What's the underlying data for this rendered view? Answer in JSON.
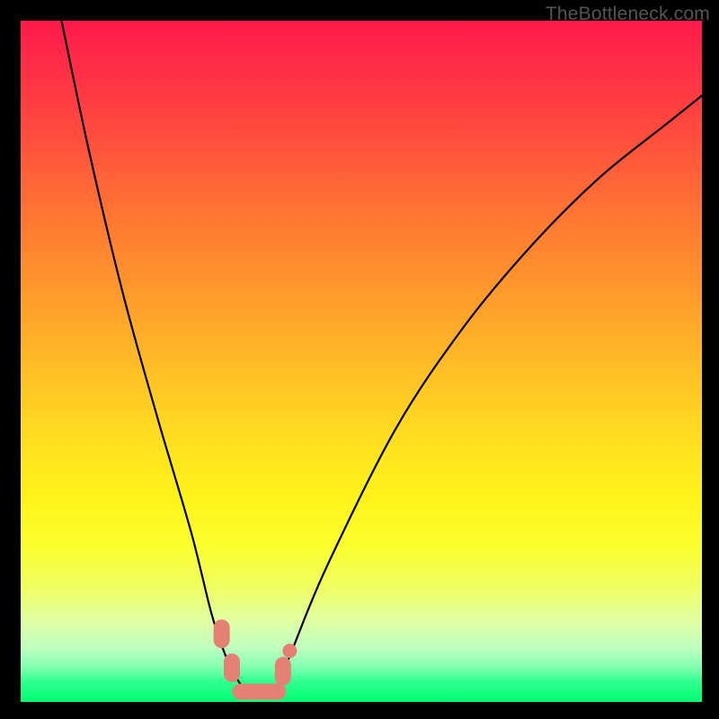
{
  "watermark": "TheBottleneck.com",
  "chart_data": {
    "type": "line",
    "title": "",
    "xlabel": "",
    "ylabel": "",
    "xlim": [
      0,
      100
    ],
    "ylim": [
      0,
      100
    ],
    "gradient": {
      "top_color": "#ff1a4a",
      "bottom_color": "#00ff70",
      "description": "vertical gradient red→orange→yellow→green"
    },
    "series": [
      {
        "name": "bottleneck-curve",
        "x": [
          6,
          10,
          15,
          20,
          25,
          28,
          30,
          32,
          33,
          34,
          35,
          36,
          37,
          38,
          40,
          45,
          55,
          65,
          75,
          85,
          95,
          100
        ],
        "y": [
          100,
          81,
          60,
          42,
          25,
          13,
          7,
          3,
          2,
          1.5,
          1.5,
          1.5,
          2,
          3,
          8,
          20,
          40,
          55,
          67,
          77,
          85,
          89
        ]
      }
    ],
    "markers": [
      {
        "name": "left-blob-upper",
        "x": 29.5,
        "y": 10,
        "shape": "pill"
      },
      {
        "name": "left-blob-lower",
        "x": 31,
        "y": 5,
        "shape": "pill"
      },
      {
        "name": "bottom-blob",
        "x": 35,
        "y": 1.5,
        "shape": "wide-pill"
      },
      {
        "name": "right-blob-lower",
        "x": 38.5,
        "y": 4.5,
        "shape": "pill"
      },
      {
        "name": "right-blob-upper",
        "x": 39.5,
        "y": 7.5,
        "shape": "dot"
      }
    ],
    "marker_color": "#e58074"
  }
}
